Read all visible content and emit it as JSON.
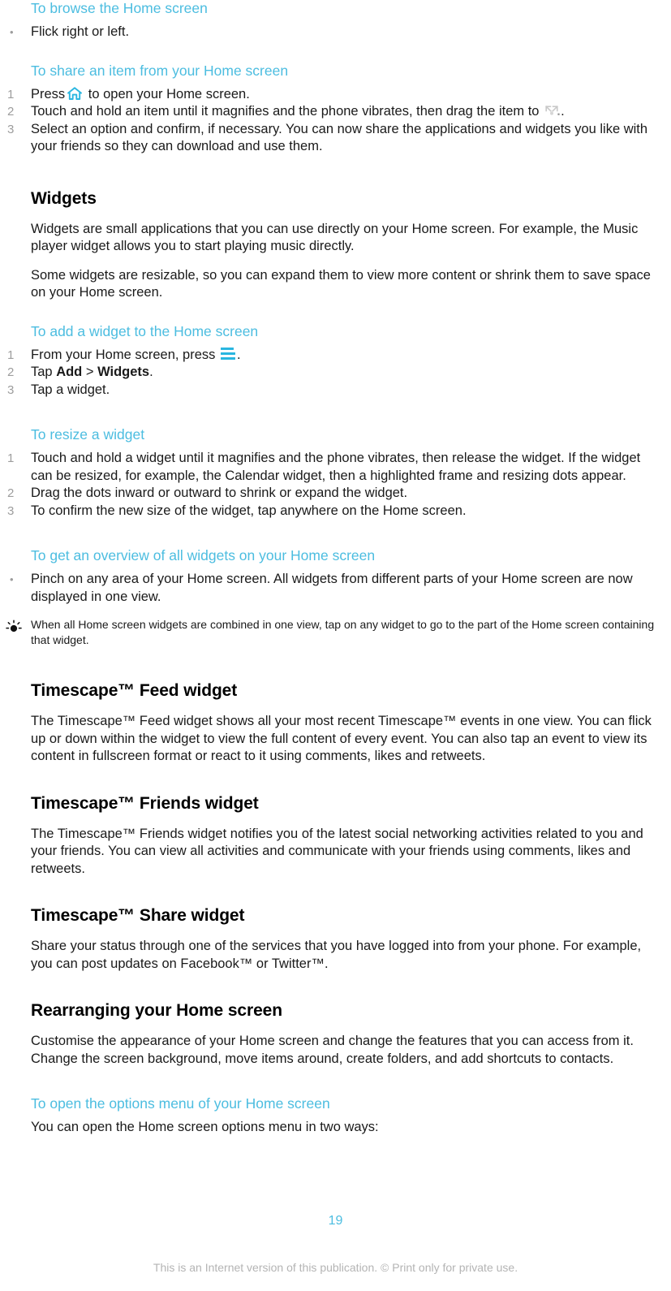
{
  "document": {
    "page_number": "19",
    "footer_note": "This is an Internet version of this publication. © Print only for private use.",
    "accent_color": "#4cbde0",
    "icon_color": "#29b6e0",
    "marker_color": "#9d9d9d"
  },
  "sections": {
    "browse_home": {
      "heading": "To browse the Home screen",
      "items": [
        {
          "marker": "•",
          "text": "Flick right or left."
        }
      ]
    },
    "share_item": {
      "heading": "To share an item from your Home screen",
      "items": [
        {
          "marker": "1",
          "prefix": "Press",
          "icon": "home-icon",
          "suffix": "to open your Home screen."
        },
        {
          "marker": "2",
          "prefix": "Touch and hold an item until it magnifies and the phone vibrates, then drag the item to",
          "icon": "share-icon",
          "suffix": "."
        },
        {
          "marker": "3",
          "text": "Select an option and confirm, if necessary. You can now share the applications and widgets you like with your friends so they can download and use them."
        }
      ]
    },
    "widgets": {
      "heading": "Widgets",
      "paragraphs": [
        "Widgets are small applications that you can use directly on your Home screen. For example, the Music player widget allows you to start playing music directly.",
        "Some widgets are resizable, so you can expand them to view more content or shrink them to save space on your Home screen."
      ]
    },
    "add_widget": {
      "heading": "To add a widget to the Home screen",
      "items": [
        {
          "marker": "1",
          "prefix": "From your Home screen, press",
          "icon": "menu-icon",
          "suffix": "."
        },
        {
          "marker": "2",
          "parts": [
            {
              "text": "Tap ",
              "bold": false
            },
            {
              "text": "Add",
              "bold": true
            },
            {
              "text": " > ",
              "bold": false
            },
            {
              "text": "Widgets",
              "bold": true
            },
            {
              "text": ".",
              "bold": false
            }
          ],
          "plain": "Tap Add > Widgets."
        },
        {
          "marker": "3",
          "text": "Tap a widget."
        }
      ]
    },
    "resize_widget": {
      "heading": "To resize a widget",
      "items": [
        {
          "marker": "1",
          "text": "Touch and hold a widget until it magnifies and the phone vibrates, then release the widget. If the widget can be resized, for example, the Calendar widget, then a highlighted frame and resizing dots appear."
        },
        {
          "marker": "2",
          "text": "Drag the dots inward or outward to shrink or expand the widget."
        },
        {
          "marker": "3",
          "text": "To confirm the new size of the widget, tap anywhere on the Home screen."
        }
      ]
    },
    "overview_widgets": {
      "heading": "To get an overview of all widgets on your Home screen",
      "items": [
        {
          "marker": "•",
          "text": "Pinch on any area of your Home screen. All widgets from different parts of your Home screen are now displayed in one view."
        }
      ],
      "tip": "When all Home screen widgets are combined in one view, tap on any widget to go to the part of the Home screen containing that widget."
    },
    "timescape_feed": {
      "heading": "Timescape™ Feed widget",
      "paragraph": "The Timescape™ Feed widget shows all your most recent Timescape™ events in one view. You can flick up or down within the widget to view the full content of every event. You can also tap an event to view its content in fullscreen format or react to it using comments, likes and retweets."
    },
    "timescape_friends": {
      "heading": "Timescape™ Friends widget",
      "paragraph": "The Timescape™ Friends widget notifies you of the latest social networking activities related to you and your friends. You can view all activities and communicate with your friends using comments, likes and retweets."
    },
    "timescape_share": {
      "heading": "Timescape™ Share widget",
      "paragraph": "Share your status through one of the services that you have logged into from your phone. For example, you can post updates on Facebook™ or Twitter™."
    },
    "rearranging": {
      "heading": "Rearranging your Home screen",
      "paragraph": "Customise the appearance of your Home screen and change the features that you can access from it. Change the screen background, move items around, create folders, and add shortcuts to contacts."
    },
    "options_menu": {
      "heading": "To open the options menu of your Home screen",
      "paragraph": "You can open the Home screen options menu in two ways:"
    }
  }
}
